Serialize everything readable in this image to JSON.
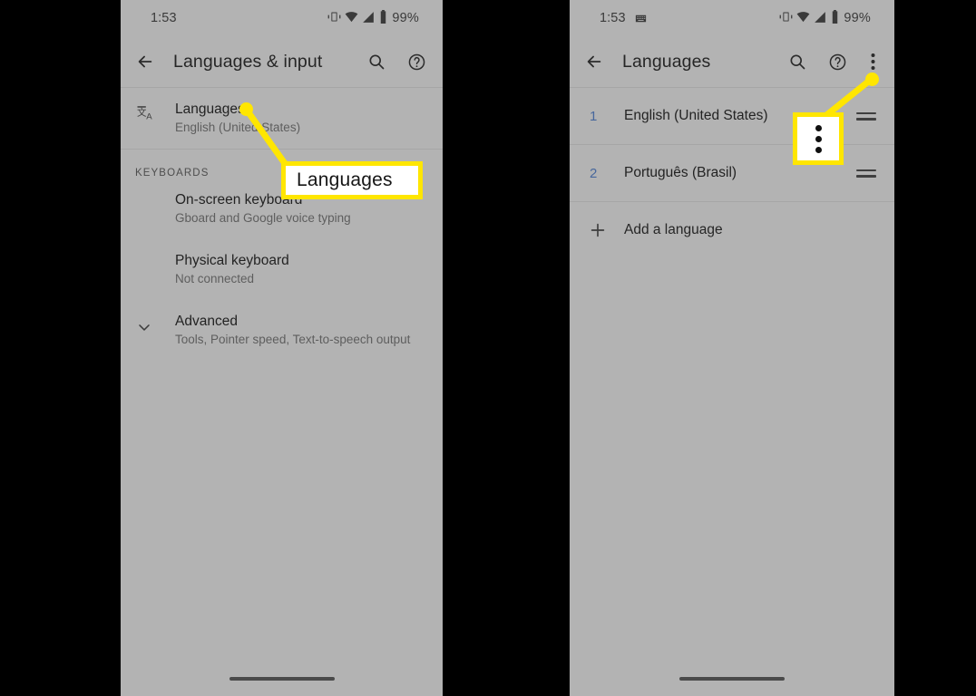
{
  "colors": {
    "backdrop": "#000000",
    "phone_bg": "#b3b3b3",
    "annotation": "#ffe600",
    "callout_fill": "#ffffff",
    "list_number": "#47679c",
    "primary_text": "#232323",
    "secondary_text": "#5e5e5e"
  },
  "left_phone": {
    "statusbar": {
      "time": "1:53",
      "battery_percent": "99%",
      "icons": [
        "vibrate-icon",
        "wifi-icon",
        "signal-icon",
        "battery-icon"
      ]
    },
    "appbar": {
      "back_icon": "back-arrow-icon",
      "title": "Languages & input",
      "actions": [
        "search-icon",
        "help-icon"
      ]
    },
    "languages_row": {
      "icon": "translate-icon",
      "title": "Languages",
      "subtitle": "English (United States)"
    },
    "section_label": "KEYBOARDS",
    "keyboard_rows": [
      {
        "title": "On-screen keyboard",
        "subtitle": "Gboard and Google voice typing",
        "icon": ""
      },
      {
        "title": "Physical keyboard",
        "subtitle": "Not connected",
        "icon": ""
      },
      {
        "title": "Advanced",
        "subtitle": "Tools, Pointer speed, Text-to-speech output",
        "icon": "chevron-down-icon"
      }
    ]
  },
  "right_phone": {
    "statusbar": {
      "time": "1:53",
      "battery_percent": "99%",
      "icons": [
        "keyboard-icon",
        "vibrate-icon",
        "wifi-icon",
        "signal-icon",
        "battery-icon"
      ]
    },
    "appbar": {
      "back_icon": "back-arrow-icon",
      "title": "Languages",
      "actions": [
        "search-icon",
        "help-icon",
        "overflow-menu-icon"
      ]
    },
    "language_list": [
      {
        "number": "1",
        "name": "English (United States)",
        "handle": "drag-handle-icon"
      },
      {
        "number": "2",
        "name": "Português (Brasil)",
        "handle": "drag-handle-icon"
      }
    ],
    "add_row": {
      "icon": "plus-icon",
      "label": "Add a language"
    }
  },
  "annotations": {
    "left_callout": {
      "text": "Languages",
      "target": "languages-row"
    },
    "right_callout": {
      "icon": "overflow-menu-icon",
      "target": "overflow-menu-button"
    }
  }
}
